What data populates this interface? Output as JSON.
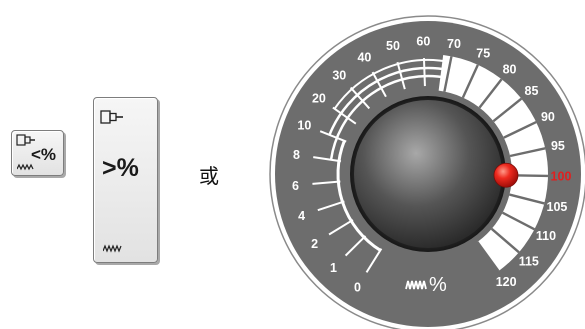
{
  "keys": {
    "decrease": {
      "label": "<%",
      "spindle_icon": "spindle-icon",
      "feed_icon": "feed-rate-icon"
    },
    "increase": {
      "label": ">%",
      "spindle_icon": "spindle-icon",
      "feed_icon": "feed-rate-icon"
    }
  },
  "separator": {
    "text": "或"
  },
  "dial": {
    "ticks": [
      "0",
      "1",
      "2",
      "4",
      "6",
      "8",
      "10",
      "20",
      "30",
      "40",
      "50",
      "60",
      "70",
      "75",
      "80",
      "85",
      "90",
      "95",
      "100",
      "105",
      "110",
      "115",
      "120"
    ],
    "current_value": "100",
    "unit_label": "%",
    "unit_icon": "feed-rate-icon",
    "colors": {
      "face": "#6d6d6d",
      "highlight_tick": "#e02020",
      "indicator": "#e8231c",
      "scale_band": "#ffffff"
    }
  }
}
